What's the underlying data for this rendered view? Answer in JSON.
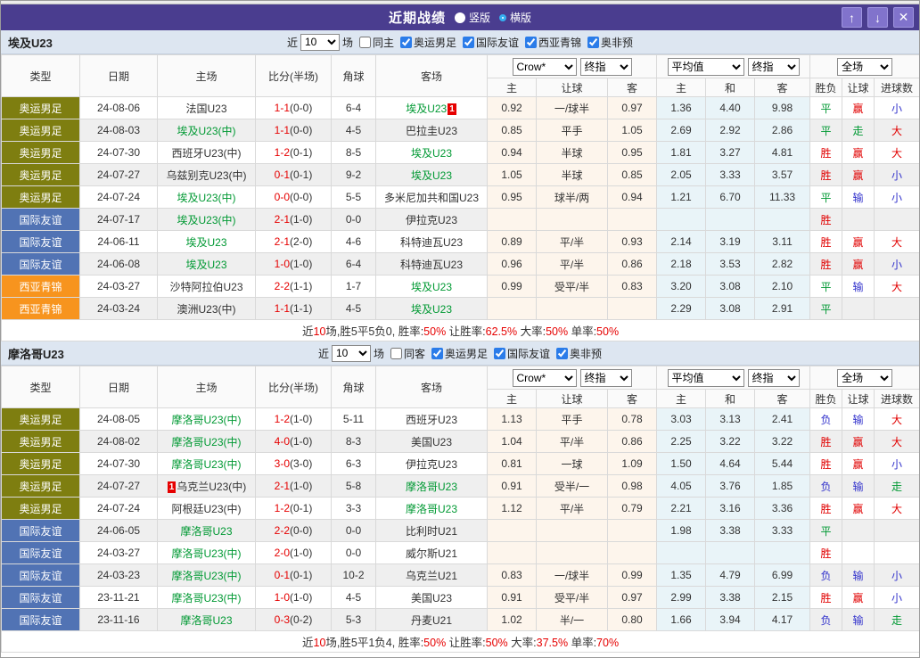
{
  "title_bar": {
    "title": "近期战绩",
    "layout_vertical": "竖版",
    "layout_horizontal": "横版",
    "selected_layout": "横版",
    "buttons": {
      "up": "↑",
      "down": "↓",
      "close": "✕"
    }
  },
  "colors": {
    "titlebar_bg": "#4a3d8f",
    "type": {
      "olive": "#7e7e10",
      "blue": "#5173b4",
      "orange": "#f7941e"
    },
    "result": {
      "r": "#e10000",
      "g": "#009933",
      "b": "#3333cc"
    },
    "score_red": "#e60000",
    "team_green": "#009933",
    "badge_red": "#e60000"
  },
  "table": {
    "columns": [
      "类型",
      "日期",
      "主场",
      "比分(半场)",
      "角球",
      "客场"
    ],
    "handicap_columns": [
      "主",
      "让球",
      "客"
    ],
    "average_columns": [
      "主",
      "和",
      "客"
    ],
    "result_columns": [
      "胜负",
      "让球",
      "进球数"
    ],
    "selects": {
      "source": "Crow*",
      "final1": "终指",
      "average": "平均值",
      "final2": "终指",
      "scope": "全场"
    }
  },
  "filter_labels": {
    "recent_prefix": "近",
    "recent_suffix": "场"
  },
  "sections": [
    {
      "team": "埃及U23",
      "filters": {
        "count": "10",
        "same": "同主",
        "same_checked": false,
        "leagues": [
          "奥运男足",
          "国际友谊",
          "西亚青锦",
          "奥非预"
        ]
      },
      "rows": [
        {
          "type": "奥运男足",
          "tc": "olive",
          "date": "24-08-06",
          "home": {
            "n": "法国U23"
          },
          "score": "1-1",
          "half": "(0-0)",
          "corner": "6-4",
          "away": {
            "n": "埃及U23",
            "g": 1,
            "b": "1"
          },
          "hcp": [
            "0.92",
            "一/球半",
            "0.97"
          ],
          "avg": [
            "1.36",
            "4.40",
            "9.98"
          ],
          "res": [
            [
              "平",
              "g"
            ],
            [
              "赢",
              "r"
            ],
            [
              "小",
              "b"
            ]
          ]
        },
        {
          "type": "奥运男足",
          "tc": "olive",
          "date": "24-08-03",
          "home": {
            "n": "埃及U23(中)",
            "g": 1
          },
          "score": "1-1",
          "half": "(0-0)",
          "corner": "4-5",
          "away": {
            "n": "巴拉圭U23"
          },
          "hcp": [
            "0.85",
            "平手",
            "1.05"
          ],
          "avg": [
            "2.69",
            "2.92",
            "2.86"
          ],
          "res": [
            [
              "平",
              "g"
            ],
            [
              "走",
              "g"
            ],
            [
              "大",
              "r"
            ]
          ]
        },
        {
          "type": "奥运男足",
          "tc": "olive",
          "date": "24-07-30",
          "home": {
            "n": "西班牙U23(中)"
          },
          "score": "1-2",
          "half": "(0-1)",
          "corner": "8-5",
          "away": {
            "n": "埃及U23",
            "g": 1
          },
          "hcp": [
            "0.94",
            "半球",
            "0.95"
          ],
          "avg": [
            "1.81",
            "3.27",
            "4.81"
          ],
          "res": [
            [
              "胜",
              "r"
            ],
            [
              "赢",
              "r"
            ],
            [
              "大",
              "r"
            ]
          ]
        },
        {
          "type": "奥运男足",
          "tc": "olive",
          "date": "24-07-27",
          "home": {
            "n": "乌兹别克U23(中)"
          },
          "score": "0-1",
          "half": "(0-1)",
          "corner": "9-2",
          "away": {
            "n": "埃及U23",
            "g": 1
          },
          "hcp": [
            "1.05",
            "半球",
            "0.85"
          ],
          "avg": [
            "2.05",
            "3.33",
            "3.57"
          ],
          "res": [
            [
              "胜",
              "r"
            ],
            [
              "赢",
              "r"
            ],
            [
              "小",
              "b"
            ]
          ]
        },
        {
          "type": "奥运男足",
          "tc": "olive",
          "date": "24-07-24",
          "home": {
            "n": "埃及U23(中)",
            "g": 1
          },
          "score": "0-0",
          "half": "(0-0)",
          "corner": "5-5",
          "away": {
            "n": "多米尼加共和国U23"
          },
          "hcp": [
            "0.95",
            "球半/两",
            "0.94"
          ],
          "avg": [
            "1.21",
            "6.70",
            "11.33"
          ],
          "res": [
            [
              "平",
              "g"
            ],
            [
              "输",
              "b"
            ],
            [
              "小",
              "b"
            ]
          ]
        },
        {
          "type": "国际友谊",
          "tc": "blue",
          "date": "24-07-17",
          "home": {
            "n": "埃及U23(中)",
            "g": 1
          },
          "score": "2-1",
          "half": "(1-0)",
          "corner": "0-0",
          "away": {
            "n": "伊拉克U23"
          },
          "hcp": [
            "",
            "",
            ""
          ],
          "avg": [
            "",
            "",
            ""
          ],
          "res": [
            [
              "胜",
              "r"
            ],
            [
              "",
              ""
            ],
            [
              "",
              ""
            ]
          ]
        },
        {
          "type": "国际友谊",
          "tc": "blue",
          "date": "24-06-11",
          "home": {
            "n": "埃及U23",
            "g": 1
          },
          "score": "2-1",
          "half": "(2-0)",
          "corner": "4-6",
          "away": {
            "n": "科特迪瓦U23"
          },
          "hcp": [
            "0.89",
            "平/半",
            "0.93"
          ],
          "avg": [
            "2.14",
            "3.19",
            "3.11"
          ],
          "res": [
            [
              "胜",
              "r"
            ],
            [
              "赢",
              "r"
            ],
            [
              "大",
              "r"
            ]
          ]
        },
        {
          "type": "国际友谊",
          "tc": "blue",
          "date": "24-06-08",
          "home": {
            "n": "埃及U23",
            "g": 1
          },
          "score": "1-0",
          "half": "(1-0)",
          "corner": "6-4",
          "away": {
            "n": "科特迪瓦U23"
          },
          "hcp": [
            "0.96",
            "平/半",
            "0.86"
          ],
          "avg": [
            "2.18",
            "3.53",
            "2.82"
          ],
          "res": [
            [
              "胜",
              "r"
            ],
            [
              "赢",
              "r"
            ],
            [
              "小",
              "b"
            ]
          ]
        },
        {
          "type": "西亚青锦",
          "tc": "orange",
          "date": "24-03-27",
          "home": {
            "n": "沙特阿拉伯U23"
          },
          "score": "2-2",
          "half": "(1-1)",
          "corner": "1-7",
          "away": {
            "n": "埃及U23",
            "g": 1
          },
          "hcp": [
            "0.99",
            "受平/半",
            "0.83"
          ],
          "avg": [
            "3.20",
            "3.08",
            "2.10"
          ],
          "res": [
            [
              "平",
              "g"
            ],
            [
              "输",
              "b"
            ],
            [
              "大",
              "r"
            ]
          ]
        },
        {
          "type": "西亚青锦",
          "tc": "orange",
          "date": "24-03-24",
          "home": {
            "n": "澳洲U23(中)"
          },
          "score": "1-1",
          "half": "(1-1)",
          "corner": "4-5",
          "away": {
            "n": "埃及U23",
            "g": 1
          },
          "hcp": [
            "",
            "",
            ""
          ],
          "avg": [
            "2.29",
            "3.08",
            "2.91"
          ],
          "res": [
            [
              "平",
              "g"
            ],
            [
              "",
              ""
            ],
            [
              "",
              ""
            ]
          ]
        }
      ],
      "summary": [
        {
          "t": "近"
        },
        {
          "t": "10",
          "r": 1
        },
        {
          "t": "场,胜5平5负0, 胜率:"
        },
        {
          "t": "50%",
          "r": 1
        },
        {
          "t": " 让胜率:"
        },
        {
          "t": "62.5%",
          "r": 1
        },
        {
          "t": " 大率:"
        },
        {
          "t": "50%",
          "r": 1
        },
        {
          "t": " 单率:"
        },
        {
          "t": "50%",
          "r": 1
        }
      ]
    },
    {
      "team": "摩洛哥U23",
      "filters": {
        "count": "10",
        "same": "同客",
        "same_checked": false,
        "leagues": [
          "奥运男足",
          "国际友谊",
          "奥非预"
        ]
      },
      "rows": [
        {
          "type": "奥运男足",
          "tc": "olive",
          "date": "24-08-05",
          "home": {
            "n": "摩洛哥U23(中)",
            "g": 1
          },
          "score": "1-2",
          "half": "(1-0)",
          "corner": "5-11",
          "away": {
            "n": "西班牙U23"
          },
          "hcp": [
            "1.13",
            "平手",
            "0.78"
          ],
          "avg": [
            "3.03",
            "3.13",
            "2.41"
          ],
          "res": [
            [
              "负",
              "b"
            ],
            [
              "输",
              "b"
            ],
            [
              "大",
              "r"
            ]
          ]
        },
        {
          "type": "奥运男足",
          "tc": "olive",
          "date": "24-08-02",
          "home": {
            "n": "摩洛哥U23(中)",
            "g": 1
          },
          "score": "4-0",
          "half": "(1-0)",
          "corner": "8-3",
          "away": {
            "n": "美国U23"
          },
          "hcp": [
            "1.04",
            "平/半",
            "0.86"
          ],
          "avg": [
            "2.25",
            "3.22",
            "3.22"
          ],
          "res": [
            [
              "胜",
              "r"
            ],
            [
              "赢",
              "r"
            ],
            [
              "大",
              "r"
            ]
          ]
        },
        {
          "type": "奥运男足",
          "tc": "olive",
          "date": "24-07-30",
          "home": {
            "n": "摩洛哥U23(中)",
            "g": 1
          },
          "score": "3-0",
          "half": "(3-0)",
          "corner": "6-3",
          "away": {
            "n": "伊拉克U23"
          },
          "hcp": [
            "0.81",
            "一球",
            "1.09"
          ],
          "avg": [
            "1.50",
            "4.64",
            "5.44"
          ],
          "res": [
            [
              "胜",
              "r"
            ],
            [
              "赢",
              "r"
            ],
            [
              "小",
              "b"
            ]
          ]
        },
        {
          "type": "奥运男足",
          "tc": "olive",
          "date": "24-07-27",
          "home": {
            "n": "乌克兰U23(中)",
            "b": "1"
          },
          "score": "2-1",
          "half": "(1-0)",
          "corner": "5-8",
          "away": {
            "n": "摩洛哥U23",
            "g": 1
          },
          "hcp": [
            "0.91",
            "受半/一",
            "0.98"
          ],
          "avg": [
            "4.05",
            "3.76",
            "1.85"
          ],
          "res": [
            [
              "负",
              "b"
            ],
            [
              "输",
              "b"
            ],
            [
              "走",
              "g"
            ]
          ]
        },
        {
          "type": "奥运男足",
          "tc": "olive",
          "date": "24-07-24",
          "home": {
            "n": "阿根廷U23(中)"
          },
          "score": "1-2",
          "half": "(0-1)",
          "corner": "3-3",
          "away": {
            "n": "摩洛哥U23",
            "g": 1
          },
          "hcp": [
            "1.12",
            "平/半",
            "0.79"
          ],
          "avg": [
            "2.21",
            "3.16",
            "3.36"
          ],
          "res": [
            [
              "胜",
              "r"
            ],
            [
              "赢",
              "r"
            ],
            [
              "大",
              "r"
            ]
          ]
        },
        {
          "type": "国际友谊",
          "tc": "blue",
          "date": "24-06-05",
          "home": {
            "n": "摩洛哥U23",
            "g": 1
          },
          "score": "2-2",
          "half": "(0-0)",
          "corner": "0-0",
          "away": {
            "n": "比利时U21"
          },
          "hcp": [
            "",
            "",
            ""
          ],
          "avg": [
            "1.98",
            "3.38",
            "3.33"
          ],
          "res": [
            [
              "平",
              "g"
            ],
            [
              "",
              ""
            ],
            [
              "",
              ""
            ]
          ]
        },
        {
          "type": "国际友谊",
          "tc": "blue",
          "date": "24-03-27",
          "home": {
            "n": "摩洛哥U23(中)",
            "g": 1
          },
          "score": "2-0",
          "half": "(1-0)",
          "corner": "0-0",
          "away": {
            "n": "威尔斯U21"
          },
          "hcp": [
            "",
            "",
            ""
          ],
          "avg": [
            "",
            "",
            ""
          ],
          "res": [
            [
              "胜",
              "r"
            ],
            [
              "",
              ""
            ],
            [
              "",
              ""
            ]
          ]
        },
        {
          "type": "国际友谊",
          "tc": "blue",
          "date": "24-03-23",
          "home": {
            "n": "摩洛哥U23(中)",
            "g": 1
          },
          "score": "0-1",
          "half": "(0-1)",
          "corner": "10-2",
          "away": {
            "n": "乌克兰U21"
          },
          "hcp": [
            "0.83",
            "一/球半",
            "0.99"
          ],
          "avg": [
            "1.35",
            "4.79",
            "6.99"
          ],
          "res": [
            [
              "负",
              "b"
            ],
            [
              "输",
              "b"
            ],
            [
              "小",
              "b"
            ]
          ]
        },
        {
          "type": "国际友谊",
          "tc": "blue",
          "date": "23-11-21",
          "home": {
            "n": "摩洛哥U23(中)",
            "g": 1
          },
          "score": "1-0",
          "half": "(1-0)",
          "corner": "4-5",
          "away": {
            "n": "美国U23"
          },
          "hcp": [
            "0.91",
            "受平/半",
            "0.97"
          ],
          "avg": [
            "2.99",
            "3.38",
            "2.15"
          ],
          "res": [
            [
              "胜",
              "r"
            ],
            [
              "赢",
              "r"
            ],
            [
              "小",
              "b"
            ]
          ]
        },
        {
          "type": "国际友谊",
          "tc": "blue",
          "date": "23-11-16",
          "home": {
            "n": "摩洛哥U23",
            "g": 1
          },
          "score": "0-3",
          "half": "(0-2)",
          "corner": "5-3",
          "away": {
            "n": "丹麦U21"
          },
          "hcp": [
            "1.02",
            "半/一",
            "0.80"
          ],
          "avg": [
            "1.66",
            "3.94",
            "4.17"
          ],
          "res": [
            [
              "负",
              "b"
            ],
            [
              "输",
              "b"
            ],
            [
              "走",
              "g"
            ]
          ]
        }
      ],
      "summary": [
        {
          "t": "近"
        },
        {
          "t": "10",
          "r": 1
        },
        {
          "t": "场,胜5平1负4, 胜率:"
        },
        {
          "t": "50%",
          "r": 1
        },
        {
          "t": " 让胜率:"
        },
        {
          "t": "50%",
          "r": 1
        },
        {
          "t": " 大率:"
        },
        {
          "t": "37.5%",
          "r": 1
        },
        {
          "t": " 单率:"
        },
        {
          "t": "70%",
          "r": 1
        }
      ]
    }
  ]
}
